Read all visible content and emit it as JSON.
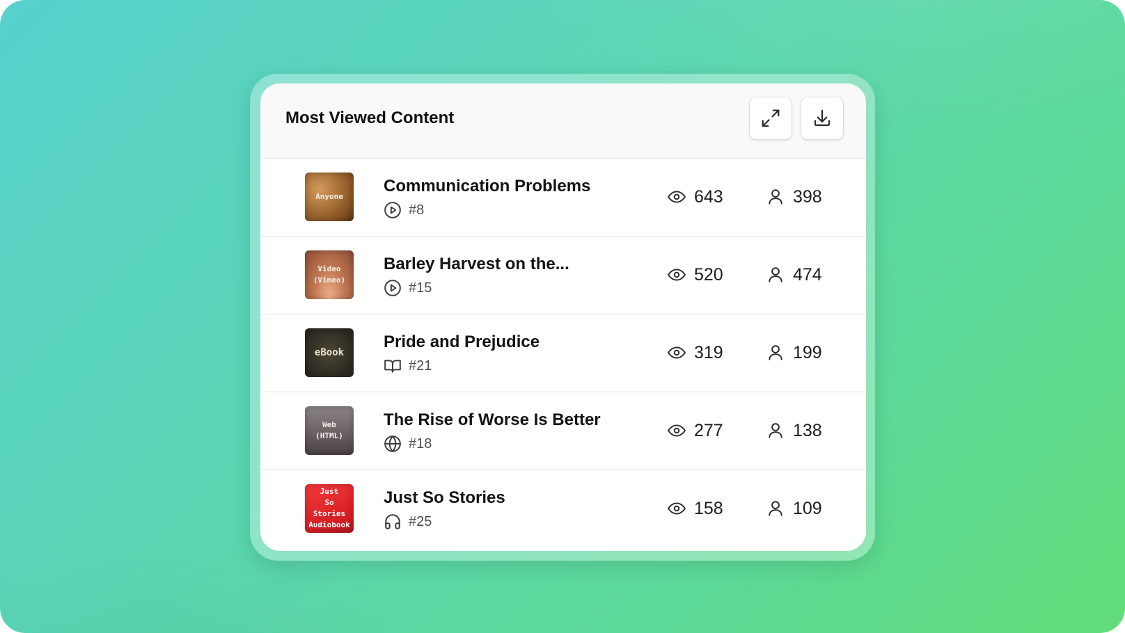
{
  "card": {
    "title": "Most Viewed Content",
    "actions": [
      {
        "name": "expand",
        "icon": "expand-icon"
      },
      {
        "name": "download",
        "icon": "download-icon"
      }
    ]
  },
  "items": [
    {
      "thumb_label": "Anyone",
      "title": "Communication Problems",
      "type_icon": "play-circle-icon",
      "rank": "#8",
      "views": "643",
      "users": "398"
    },
    {
      "thumb_label": "Video\n(Vimeo)",
      "title": "Barley Harvest on the...",
      "type_icon": "play-circle-icon",
      "rank": "#15",
      "views": "520",
      "users": "474"
    },
    {
      "thumb_label": "eBook",
      "title": "Pride and Prejudice",
      "type_icon": "book-open-icon",
      "rank": "#21",
      "views": "319",
      "users": "199"
    },
    {
      "thumb_label": "Web\n(HTML)",
      "title": "The Rise of Worse Is Better",
      "type_icon": "globe-icon",
      "rank": "#18",
      "views": "277",
      "users": "138"
    },
    {
      "thumb_label": "Just\nSo\nStories\nAudiobook",
      "title": "Just So Stories",
      "type_icon": "headphones-icon",
      "rank": "#25",
      "views": "158",
      "users": "109"
    }
  ],
  "colors": {
    "background_start": "#58d0cc",
    "background_end": "#62dc78",
    "card": "#ffffff",
    "header": "#f9f9f9",
    "text": "#141414",
    "muted": "#4d4d4d"
  }
}
